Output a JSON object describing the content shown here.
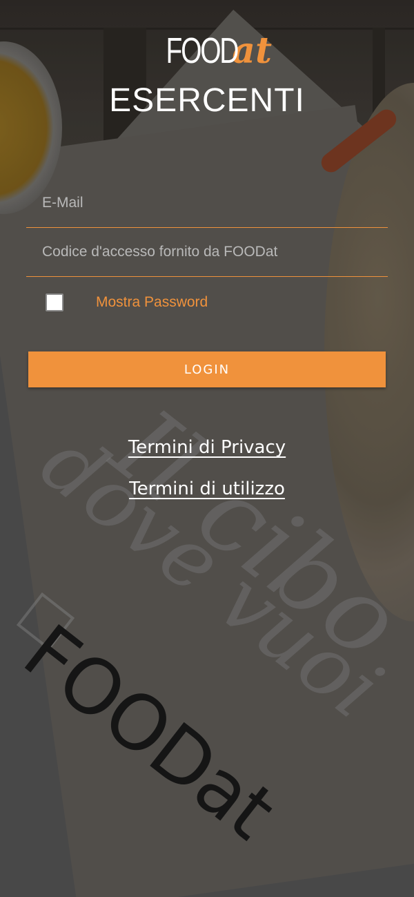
{
  "brand": {
    "logo_main": "FOOD",
    "logo_accent": "at",
    "accent_color": "#f0923c"
  },
  "header": {
    "title": "ESERCENTI"
  },
  "login_form": {
    "email_placeholder": "E-Mail",
    "email_value": "",
    "access_code_placeholder": "Codice d'accesso fornito da FOODat",
    "access_code_value": "",
    "show_password_label": "Mostra Password",
    "show_password_checked": false,
    "login_button_label": "LOGIN"
  },
  "links": {
    "privacy_label": "Termini di Privacy",
    "terms_label": "Termini di utilizzo"
  },
  "background": {
    "brand_watermark": "FOODat"
  }
}
